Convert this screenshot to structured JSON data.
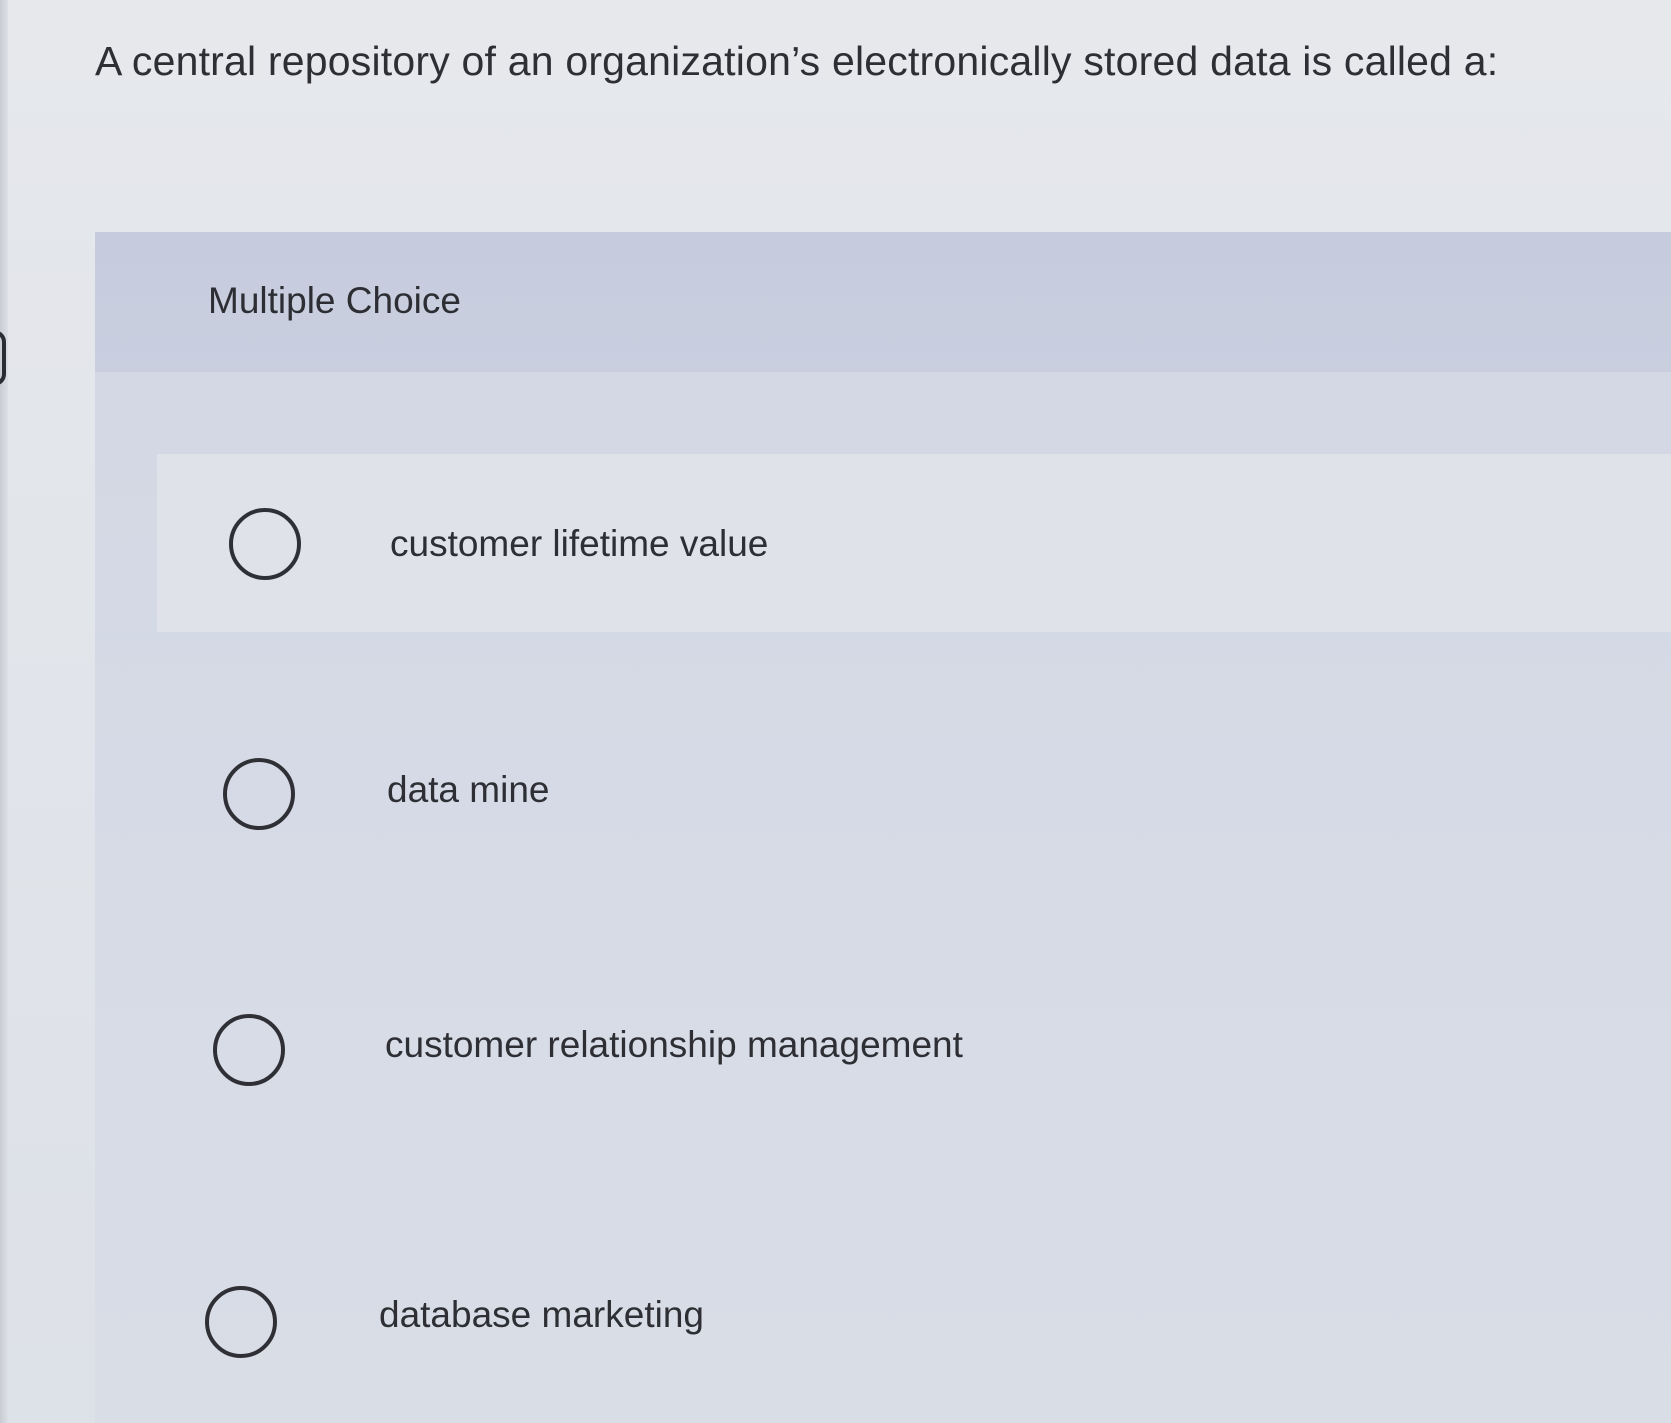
{
  "question": {
    "text": "A central repository of an organization’s electronically stored data is called a:"
  },
  "multiple_choice": {
    "header_label": "Multiple Choice",
    "options": [
      {
        "label": "customer lifetime value"
      },
      {
        "label": "data mine"
      },
      {
        "label": "customer relationship management"
      },
      {
        "label": "database marketing"
      }
    ]
  },
  "colors": {
    "header_band": "#c8cedf",
    "panel": "#d5dae5",
    "text": "#2e2f35"
  }
}
